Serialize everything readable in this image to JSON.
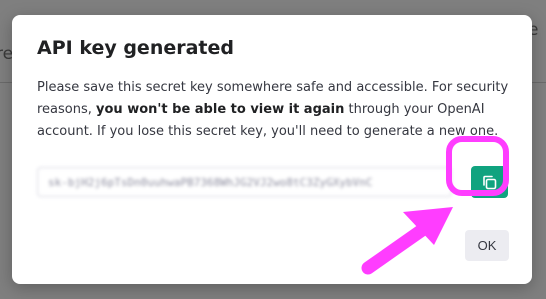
{
  "background": {
    "fragment_1": "e",
    "fragment_2": "re"
  },
  "dialog": {
    "title": "API key generated",
    "description_part1": "Please save this secret key somewhere safe and accessible. For security reasons, ",
    "description_bold": "you won't be able to view it again",
    "description_part2": " through your OpenAI account. If you lose this secret key, you'll need to generate a new one.",
    "secret_key_value": "sk-bjH2j6pTsDn0uuhwaPB7368WhJG2VJ2wo8tC3ZyGXybVnC",
    "copy_icon": "copy-icon",
    "ok_label": "OK"
  },
  "annotation": {
    "highlight_color": "#ff3dff",
    "arrow_target": "copy-button"
  },
  "colors": {
    "accent": "#10a37f",
    "overlay": "#7f7f7f"
  }
}
